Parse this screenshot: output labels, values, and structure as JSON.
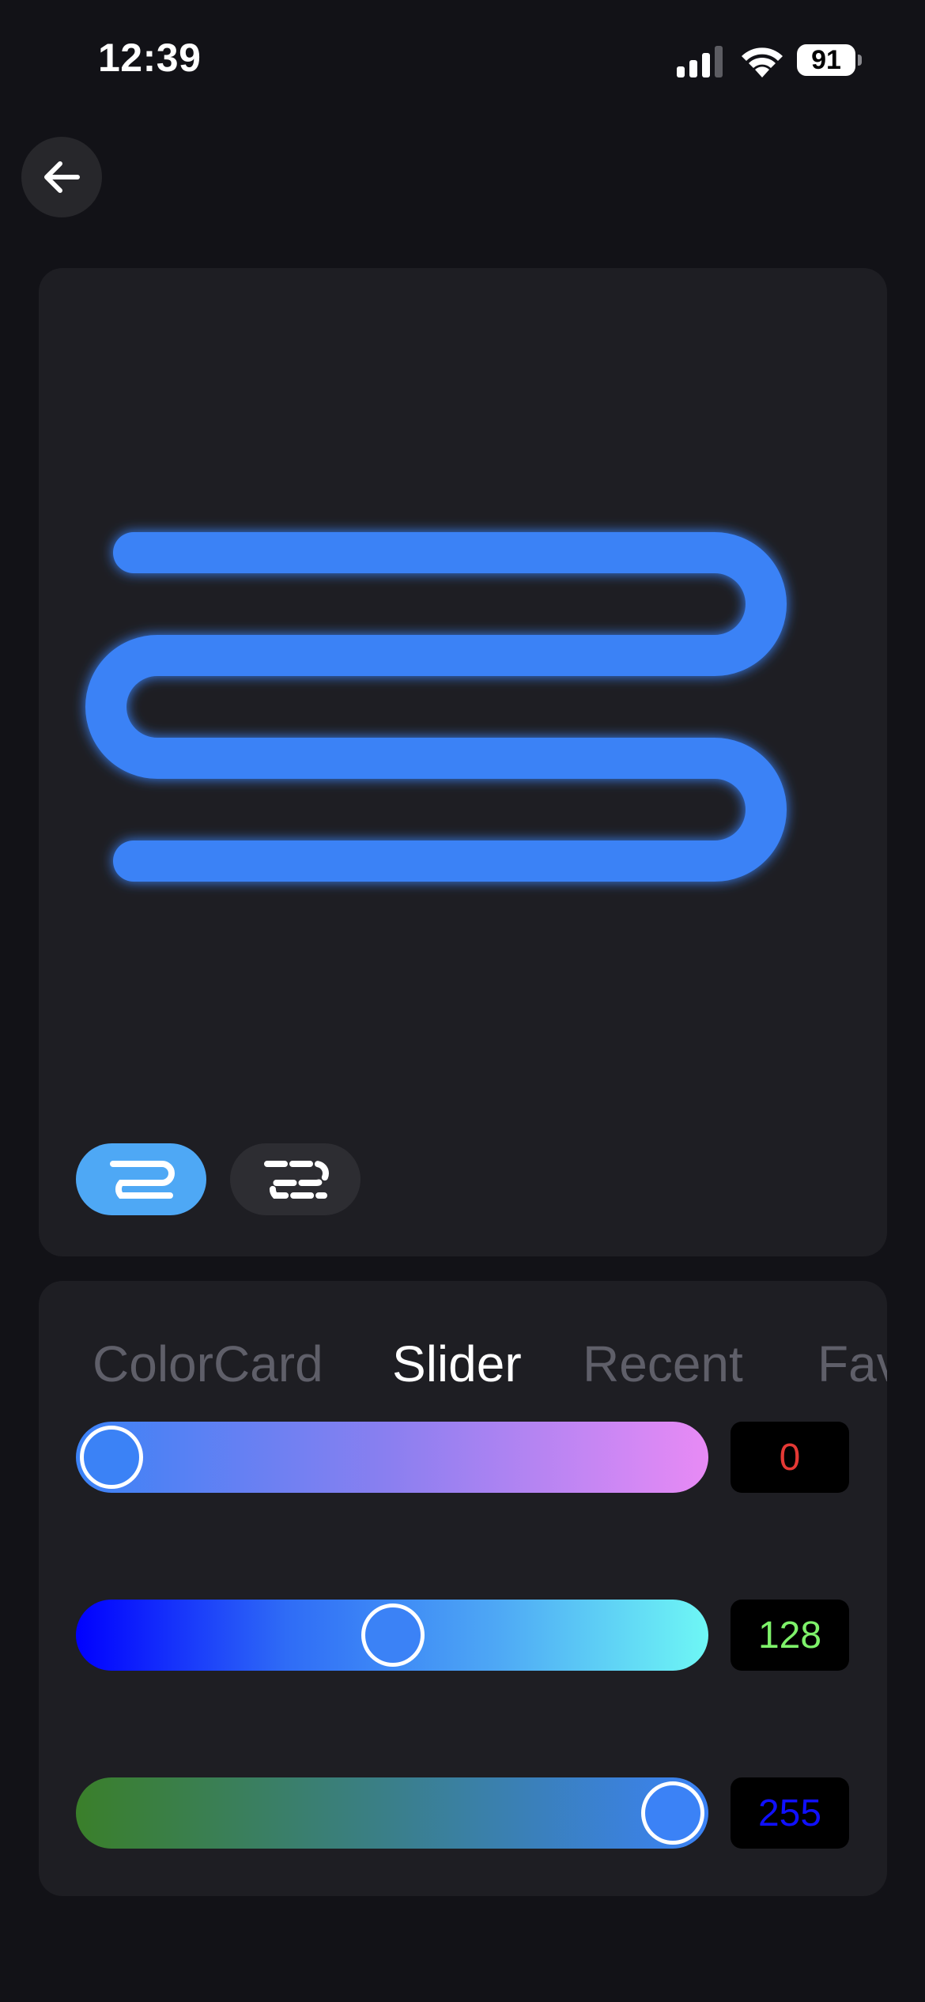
{
  "status_bar": {
    "time": "12:39",
    "battery_level": "91",
    "signal_icon": "cellular-signal-icon",
    "wifi_icon": "wifi-icon"
  },
  "header": {
    "back_icon": "arrow-left-icon"
  },
  "preview": {
    "stroke_color": "#3b82f6",
    "glow": true,
    "modes": [
      {
        "icon": "solid-line-pattern-icon",
        "active": true
      },
      {
        "icon": "dashed-line-pattern-icon",
        "active": false
      }
    ]
  },
  "controls": {
    "tabs": [
      {
        "label": "ColorCard",
        "active": false
      },
      {
        "label": "Slider",
        "active": true
      },
      {
        "label": "Recent",
        "active": false
      },
      {
        "label": "Favorites",
        "active": false
      }
    ],
    "sliders": [
      {
        "channel": "red",
        "value": "0",
        "fraction": 0.0,
        "value_color": "#e53935",
        "gradient": [
          "#3b82f6",
          "#8b7ff0",
          "#e88af5"
        ]
      },
      {
        "channel": "green",
        "value": "128",
        "fraction": 0.502,
        "value_color": "#7ef26a",
        "gradient": [
          "#0000ff",
          "#2f6cf6",
          "#4ea8f5",
          "#6ef7f5"
        ]
      },
      {
        "channel": "blue",
        "value": "255",
        "fraction": 1.0,
        "value_color": "#1010ff",
        "gradient": [
          "#3a7f2a",
          "#3a7f8a",
          "#3b82f6"
        ]
      }
    ]
  },
  "colors": {
    "background": "#121217",
    "card": "#1e1e23",
    "accent": "#3b82f6",
    "active_mode": "#4ea8f5"
  }
}
